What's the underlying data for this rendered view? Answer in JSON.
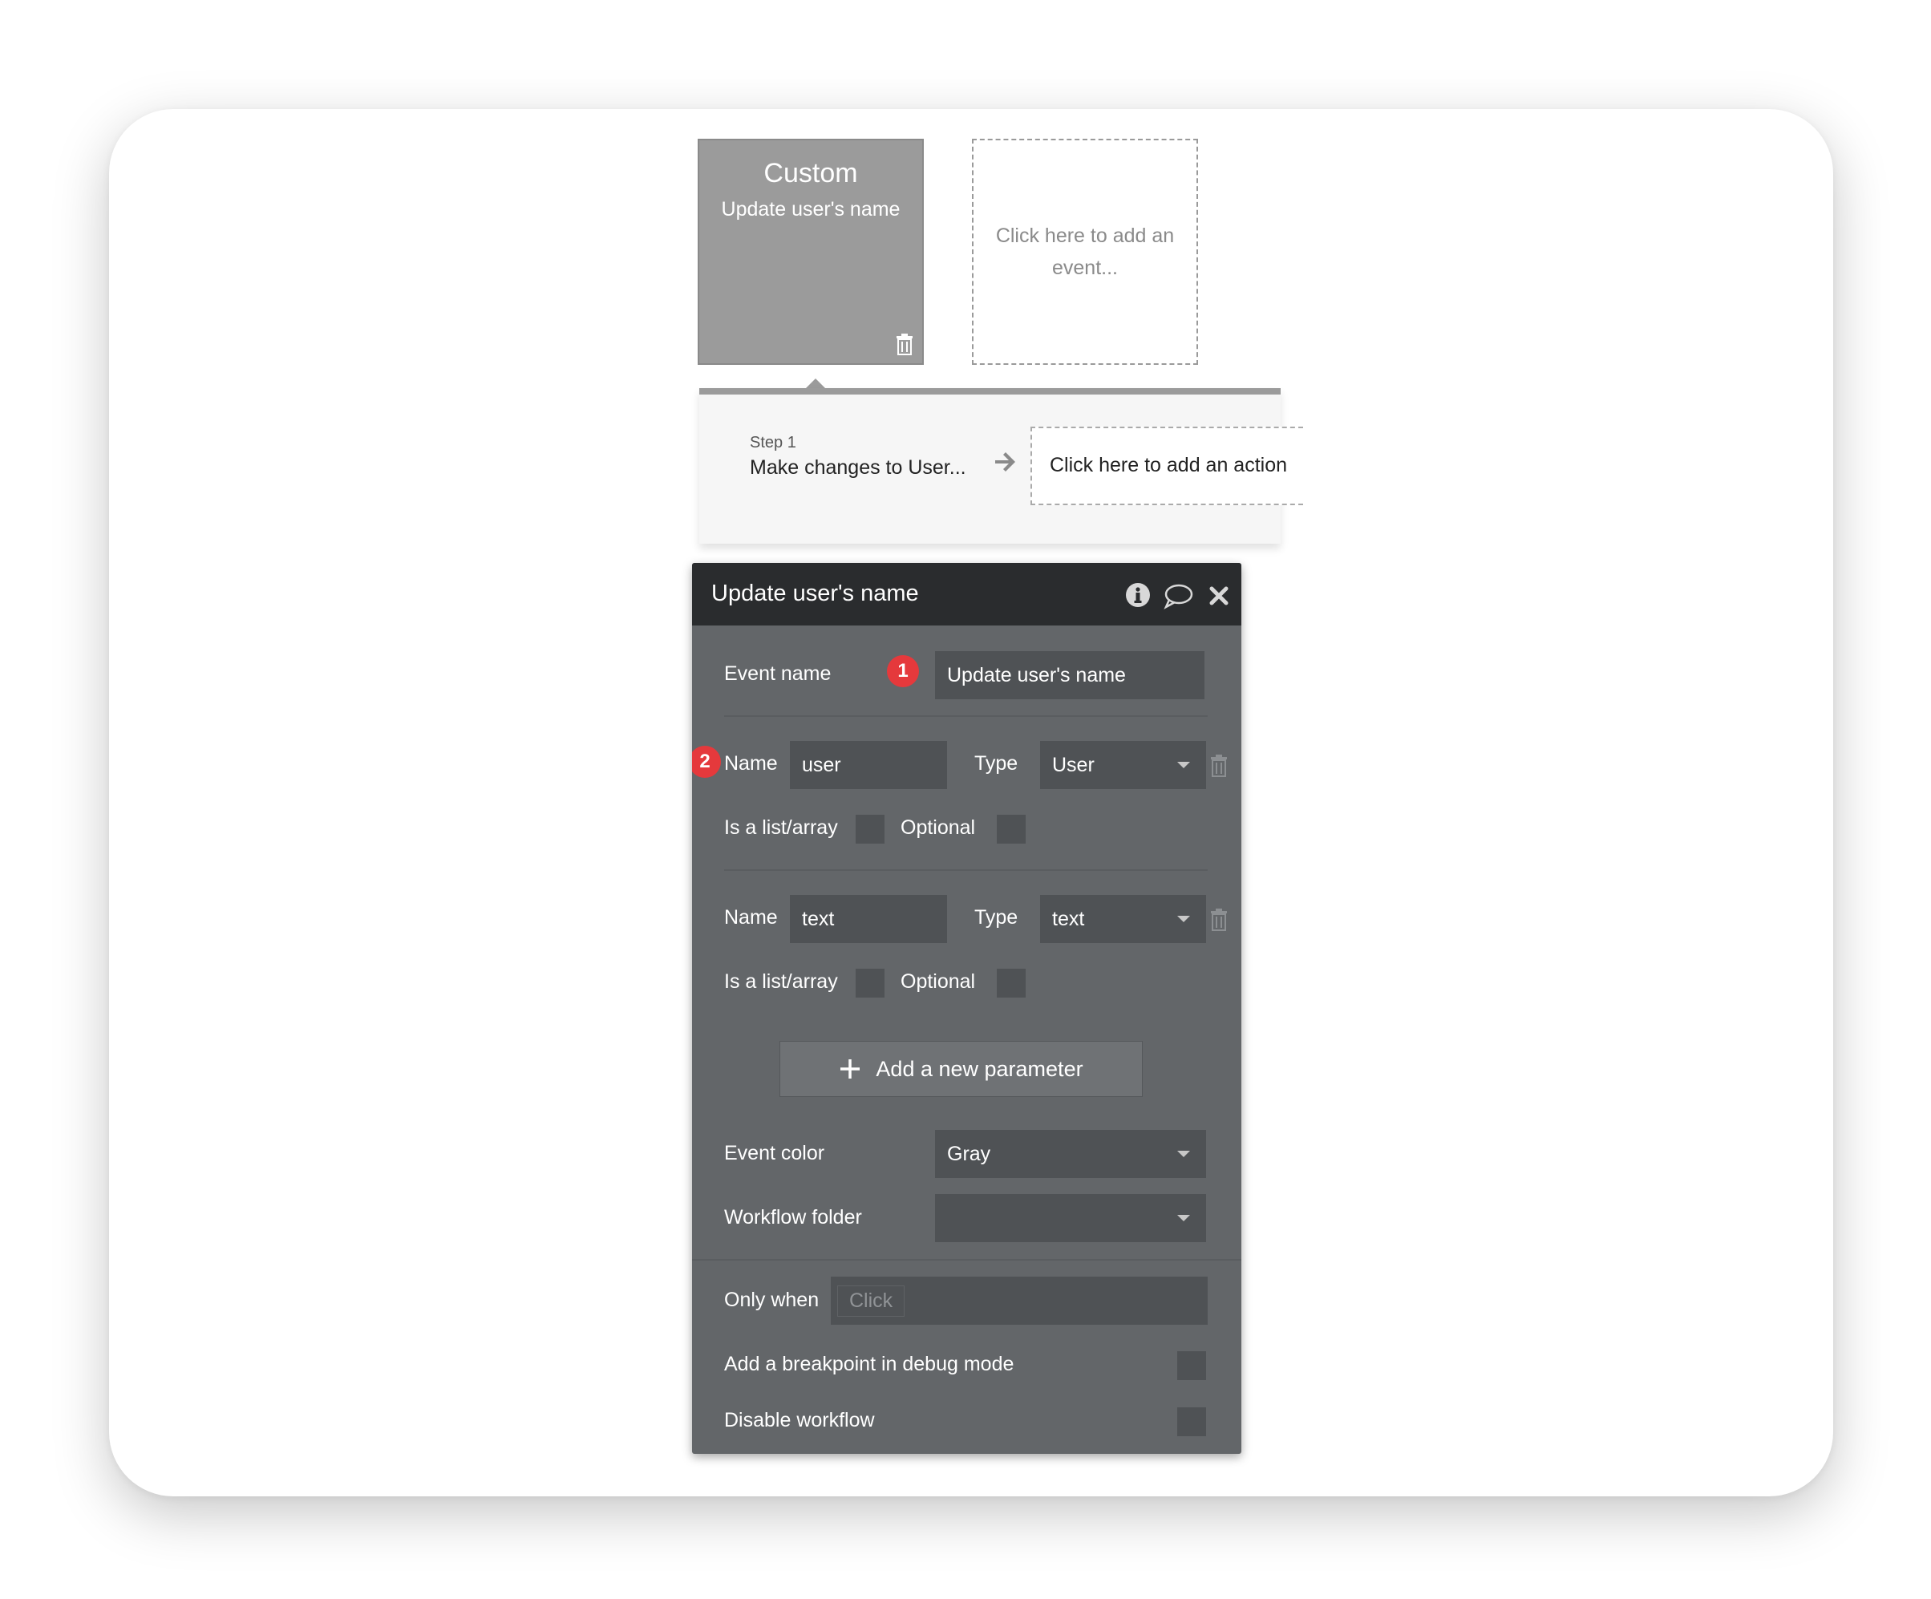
{
  "event_card": {
    "title": "Custom",
    "subtitle": "Update user's name"
  },
  "add_event": {
    "label": "Click here to add an event..."
  },
  "workflow_step": {
    "step_label": "Step 1",
    "step_title": "Make changes to User...",
    "add_action_label": "Click here to add an action"
  },
  "panel": {
    "title": "Update user's name",
    "event_name_label": "Event name",
    "event_name_value": "Update user's name",
    "badge1": "1",
    "badge2": "2",
    "parameters": [
      {
        "name_label": "Name",
        "name_value": "user",
        "type_label": "Type",
        "type_value": "User",
        "list_label": "Is a list/array",
        "optional_label": "Optional"
      },
      {
        "name_label": "Name",
        "name_value": "text",
        "type_label": "Type",
        "type_value": "text",
        "list_label": "Is a list/array",
        "optional_label": "Optional"
      }
    ],
    "add_parameter_label": "Add a new parameter",
    "event_color_label": "Event color",
    "event_color_value": "Gray",
    "workflow_folder_label": "Workflow folder",
    "workflow_folder_value": "",
    "only_when_label": "Only when",
    "only_when_placeholder": "Click",
    "breakpoint_label": "Add a breakpoint in debug mode",
    "disable_label": "Disable workflow"
  },
  "colors": {
    "panel_bg": "#636669",
    "header_bg": "#2a2c2e",
    "badge": "#e5393c",
    "event_card": "#9b9b9b"
  },
  "icons": [
    "trash-icon",
    "arrow-right-icon",
    "info-icon",
    "comment-icon",
    "close-icon",
    "plus-icon",
    "chevron-down-icon"
  ]
}
